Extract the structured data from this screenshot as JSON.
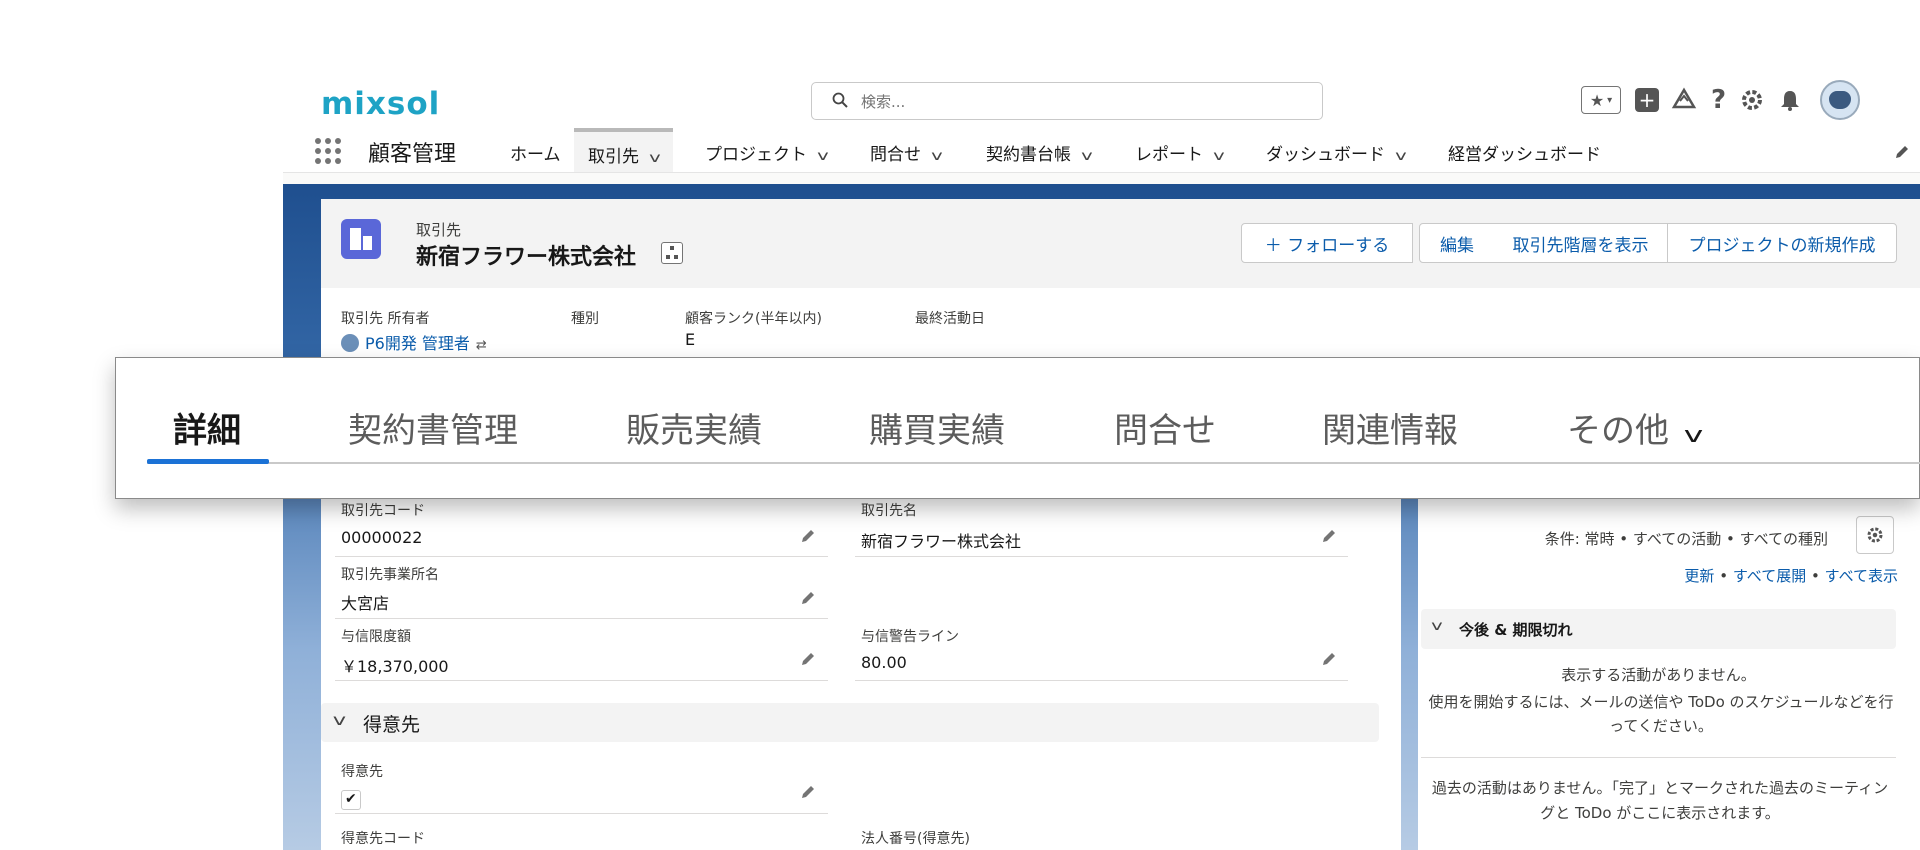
{
  "brand": {
    "logo": "mixsol"
  },
  "search": {
    "placeholder": "検索..."
  },
  "nav": {
    "app_name": "顧客管理",
    "items": [
      {
        "label": "ホーム"
      },
      {
        "label": "取引先"
      },
      {
        "label": "プロジェクト"
      },
      {
        "label": "問合せ"
      },
      {
        "label": "契約書台帳"
      },
      {
        "label": "レポート"
      },
      {
        "label": "ダッシュボード"
      },
      {
        "label": "経営ダッシュボード"
      }
    ]
  },
  "record": {
    "object_label": "取引先",
    "title": "新宿フラワー株式会社",
    "buttons": {
      "follow": "＋ フォローする",
      "edit": "編集",
      "hierarchy": "取引先階層を表示",
      "new_project": "プロジェクトの新規作成"
    },
    "highlights": {
      "owner_label": "取引先 所有者",
      "owner_value": "P6開発 管理者",
      "type_label": "種別",
      "type_value": "",
      "rank_label": "顧客ランク(半年以内)",
      "rank_value": "E",
      "last_activity_label": "最終活動日",
      "last_activity_value": ""
    }
  },
  "tabs": [
    {
      "label": "詳細"
    },
    {
      "label": "契約書管理"
    },
    {
      "label": "販売実績"
    },
    {
      "label": "購買実績"
    },
    {
      "label": "問合せ"
    },
    {
      "label": "関連情報"
    },
    {
      "label": "その他"
    }
  ],
  "details": {
    "account_code_label": "取引先コード",
    "account_code_value": "00000022",
    "account_name_label": "取引先名",
    "account_name_value": "新宿フラワー株式会社",
    "office_label": "取引先事業所名",
    "office_value": "大宮店",
    "credit_limit_label": "与信限度額",
    "credit_limit_value": "￥18,370,000",
    "credit_warning_label": "与信警告ライン",
    "credit_warning_value": "80.00",
    "section_customer": "得意先",
    "customer_label": "得意先",
    "customer_checked": true,
    "customer_code_label": "得意先コード",
    "corporate_number_label": "法人番号(得意先)"
  },
  "activity": {
    "filter_text": "条件: 常時 • すべての活動 • すべての種別",
    "link_refresh": "更新",
    "link_expand": "すべて展開",
    "link_show_all": "すべて表示",
    "dot": "•",
    "upcoming_title": "今後 & 期限切れ",
    "no_activity_line1": "表示する活動がありません。",
    "no_activity_line2": "使用を開始するには、メールの送信や ToDo のスケジュールなどを行ってください。",
    "past_line": "過去の活動はありません。「完了」とマークされた過去のミーティングと ToDo がここに表示されます。"
  }
}
